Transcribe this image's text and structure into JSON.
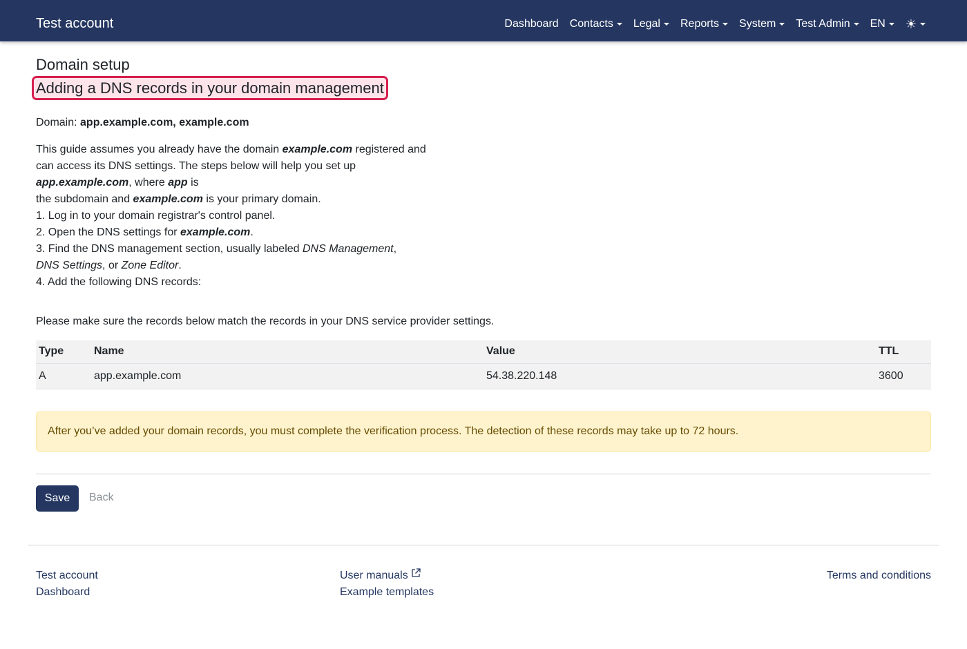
{
  "navbar": {
    "brand": "Test account",
    "items": [
      {
        "label": "Dashboard",
        "dropdown": false
      },
      {
        "label": "Contacts",
        "dropdown": true
      },
      {
        "label": "Legal",
        "dropdown": true
      },
      {
        "label": "Reports",
        "dropdown": true
      },
      {
        "label": "System",
        "dropdown": true
      },
      {
        "label": "Test Admin",
        "dropdown": true
      },
      {
        "label": "EN",
        "dropdown": true
      }
    ],
    "theme_icon": "sun-icon",
    "theme_glyph": "☀"
  },
  "page": {
    "title": "Domain setup",
    "subtitle": "Adding a DNS records in your domain management",
    "domain_label": "Domain:",
    "domain_value": "app.example.com, example.com"
  },
  "guide": {
    "l1a": "This guide assumes you already have the domain ",
    "l1b": "example.com",
    "l1c": " registered and",
    "l2": "can access its DNS settings. The steps below will help you set up",
    "l3a": "app.example.com",
    "l3b": ", where ",
    "l3c": "app",
    "l3d": " is",
    "l4a": "the subdomain and ",
    "l4b": "example.com",
    "l4c": " is your primary domain.",
    "l5": "1. Log in to your domain registrar's control panel.",
    "l6a": "2. Open the DNS settings for ",
    "l6b": "example.com",
    "l6c": ".",
    "l7a": "3. Find the DNS management section, usually labeled ",
    "l7b": "DNS Management",
    "l7c": ",",
    "l8a": "DNS Settings",
    "l8b": ", or ",
    "l8c": "Zone Editor",
    "l8d": ".",
    "l9": "4. Add the following DNS records:"
  },
  "note": "Please make sure the records below match the records in your DNS service provider settings.",
  "records": {
    "headers": {
      "type": "Type",
      "name": "Name",
      "value": "Value",
      "ttl": "TTL"
    },
    "rows": [
      {
        "type": "A",
        "name": "app.example.com",
        "value": "54.38.220.148",
        "ttl": "3600"
      }
    ]
  },
  "alert": "After you’ve added your domain records, you must complete the verification process. The detection of these records may take up to 72 hours.",
  "actions": {
    "save": "Save",
    "back": "Back"
  },
  "footer": {
    "col1": [
      "Test account",
      "Dashboard"
    ],
    "col2": [
      "User manuals",
      "Example templates"
    ],
    "col3": [
      "Terms and conditions"
    ]
  },
  "colors": {
    "navbar": "#253761",
    "highlight_border": "#d6204f",
    "alert_bg": "#fff3cd",
    "primary_button": "#253761"
  }
}
